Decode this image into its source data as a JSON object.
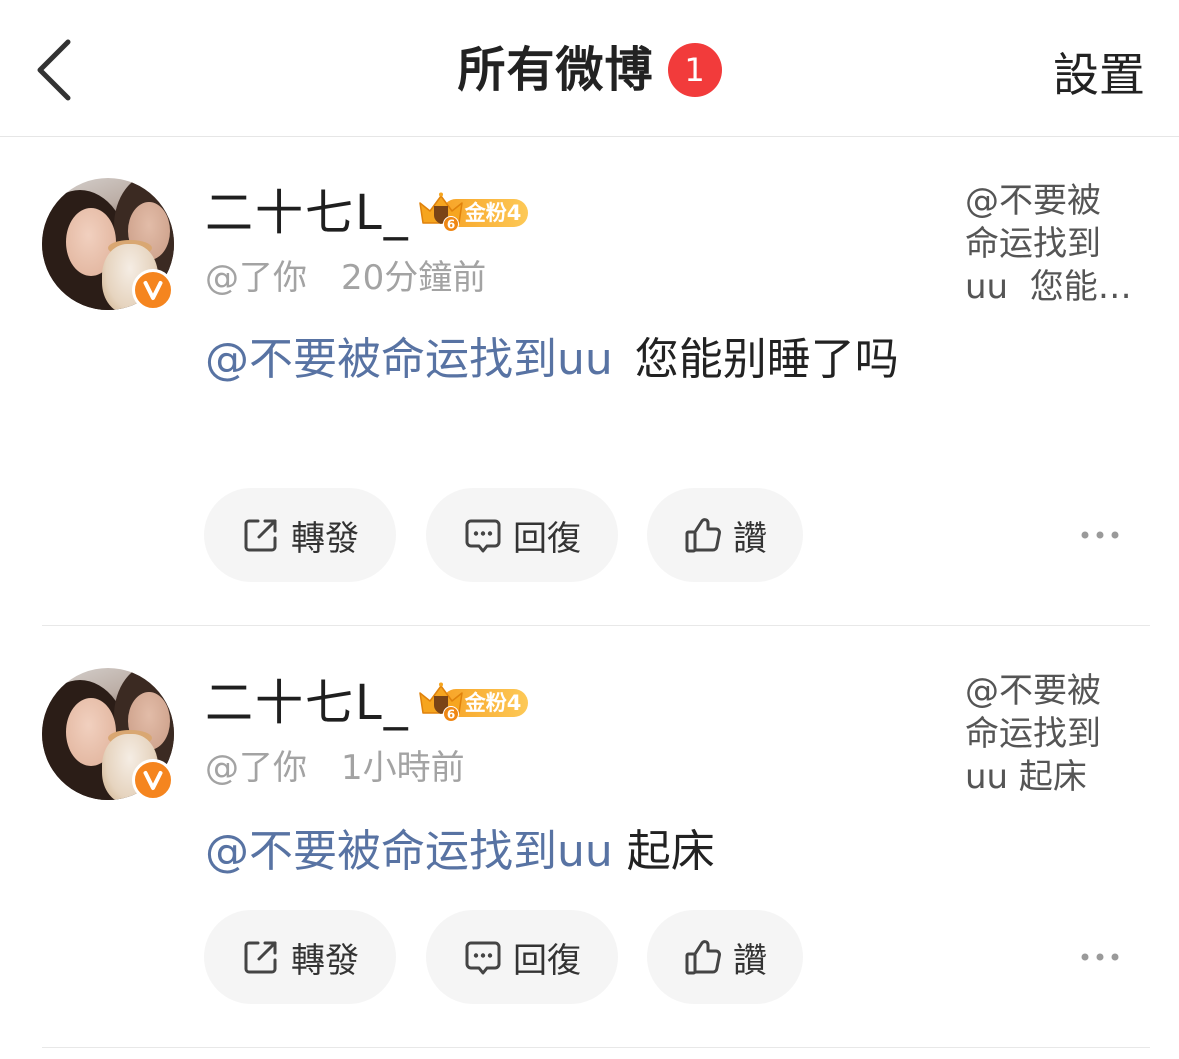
{
  "header": {
    "back_icon": "chevron-left-icon",
    "title": "所有微博",
    "badge_count": "1",
    "settings_label": "設置"
  },
  "colors": {
    "mention": "#5873a3",
    "badge_red": "#f23b3b",
    "verified_orange": "#f5851f",
    "fan_badge_gold": "#f9ae33",
    "button_bg": "#f5f5f5",
    "secondary_text": "#a3a3a3"
  },
  "action_icons": {
    "repost": "repost-icon",
    "reply": "comment-icon",
    "like": "thumbs-up-icon",
    "more": "more-dots-icon"
  },
  "posts": [
    {
      "author": "二十七L_",
      "verified_icon": "verified-v-icon",
      "fan_badge": {
        "label": "金粉4",
        "crown_level": "6",
        "icon": "crown-icon"
      },
      "handle": "@了你",
      "time": "20分鐘前",
      "mention": "@不要被命运找到uu",
      "text": "您能别睡了吗",
      "quote_lines": [
        "@不要被",
        "命运找到",
        "uu  您能…"
      ],
      "actions": {
        "repost": "轉發",
        "reply": "回復",
        "like": "讚"
      }
    },
    {
      "author": "二十七L_",
      "verified_icon": "verified-v-icon",
      "fan_badge": {
        "label": "金粉4",
        "crown_level": "6",
        "icon": "crown-icon"
      },
      "handle": "@了你",
      "time": "1小時前",
      "mention": "@不要被命运找到uu",
      "text": "起床",
      "quote_lines": [
        "@不要被",
        "命运找到",
        "uu 起床"
      ],
      "actions": {
        "repost": "轉發",
        "reply": "回復",
        "like": "讚"
      }
    }
  ]
}
